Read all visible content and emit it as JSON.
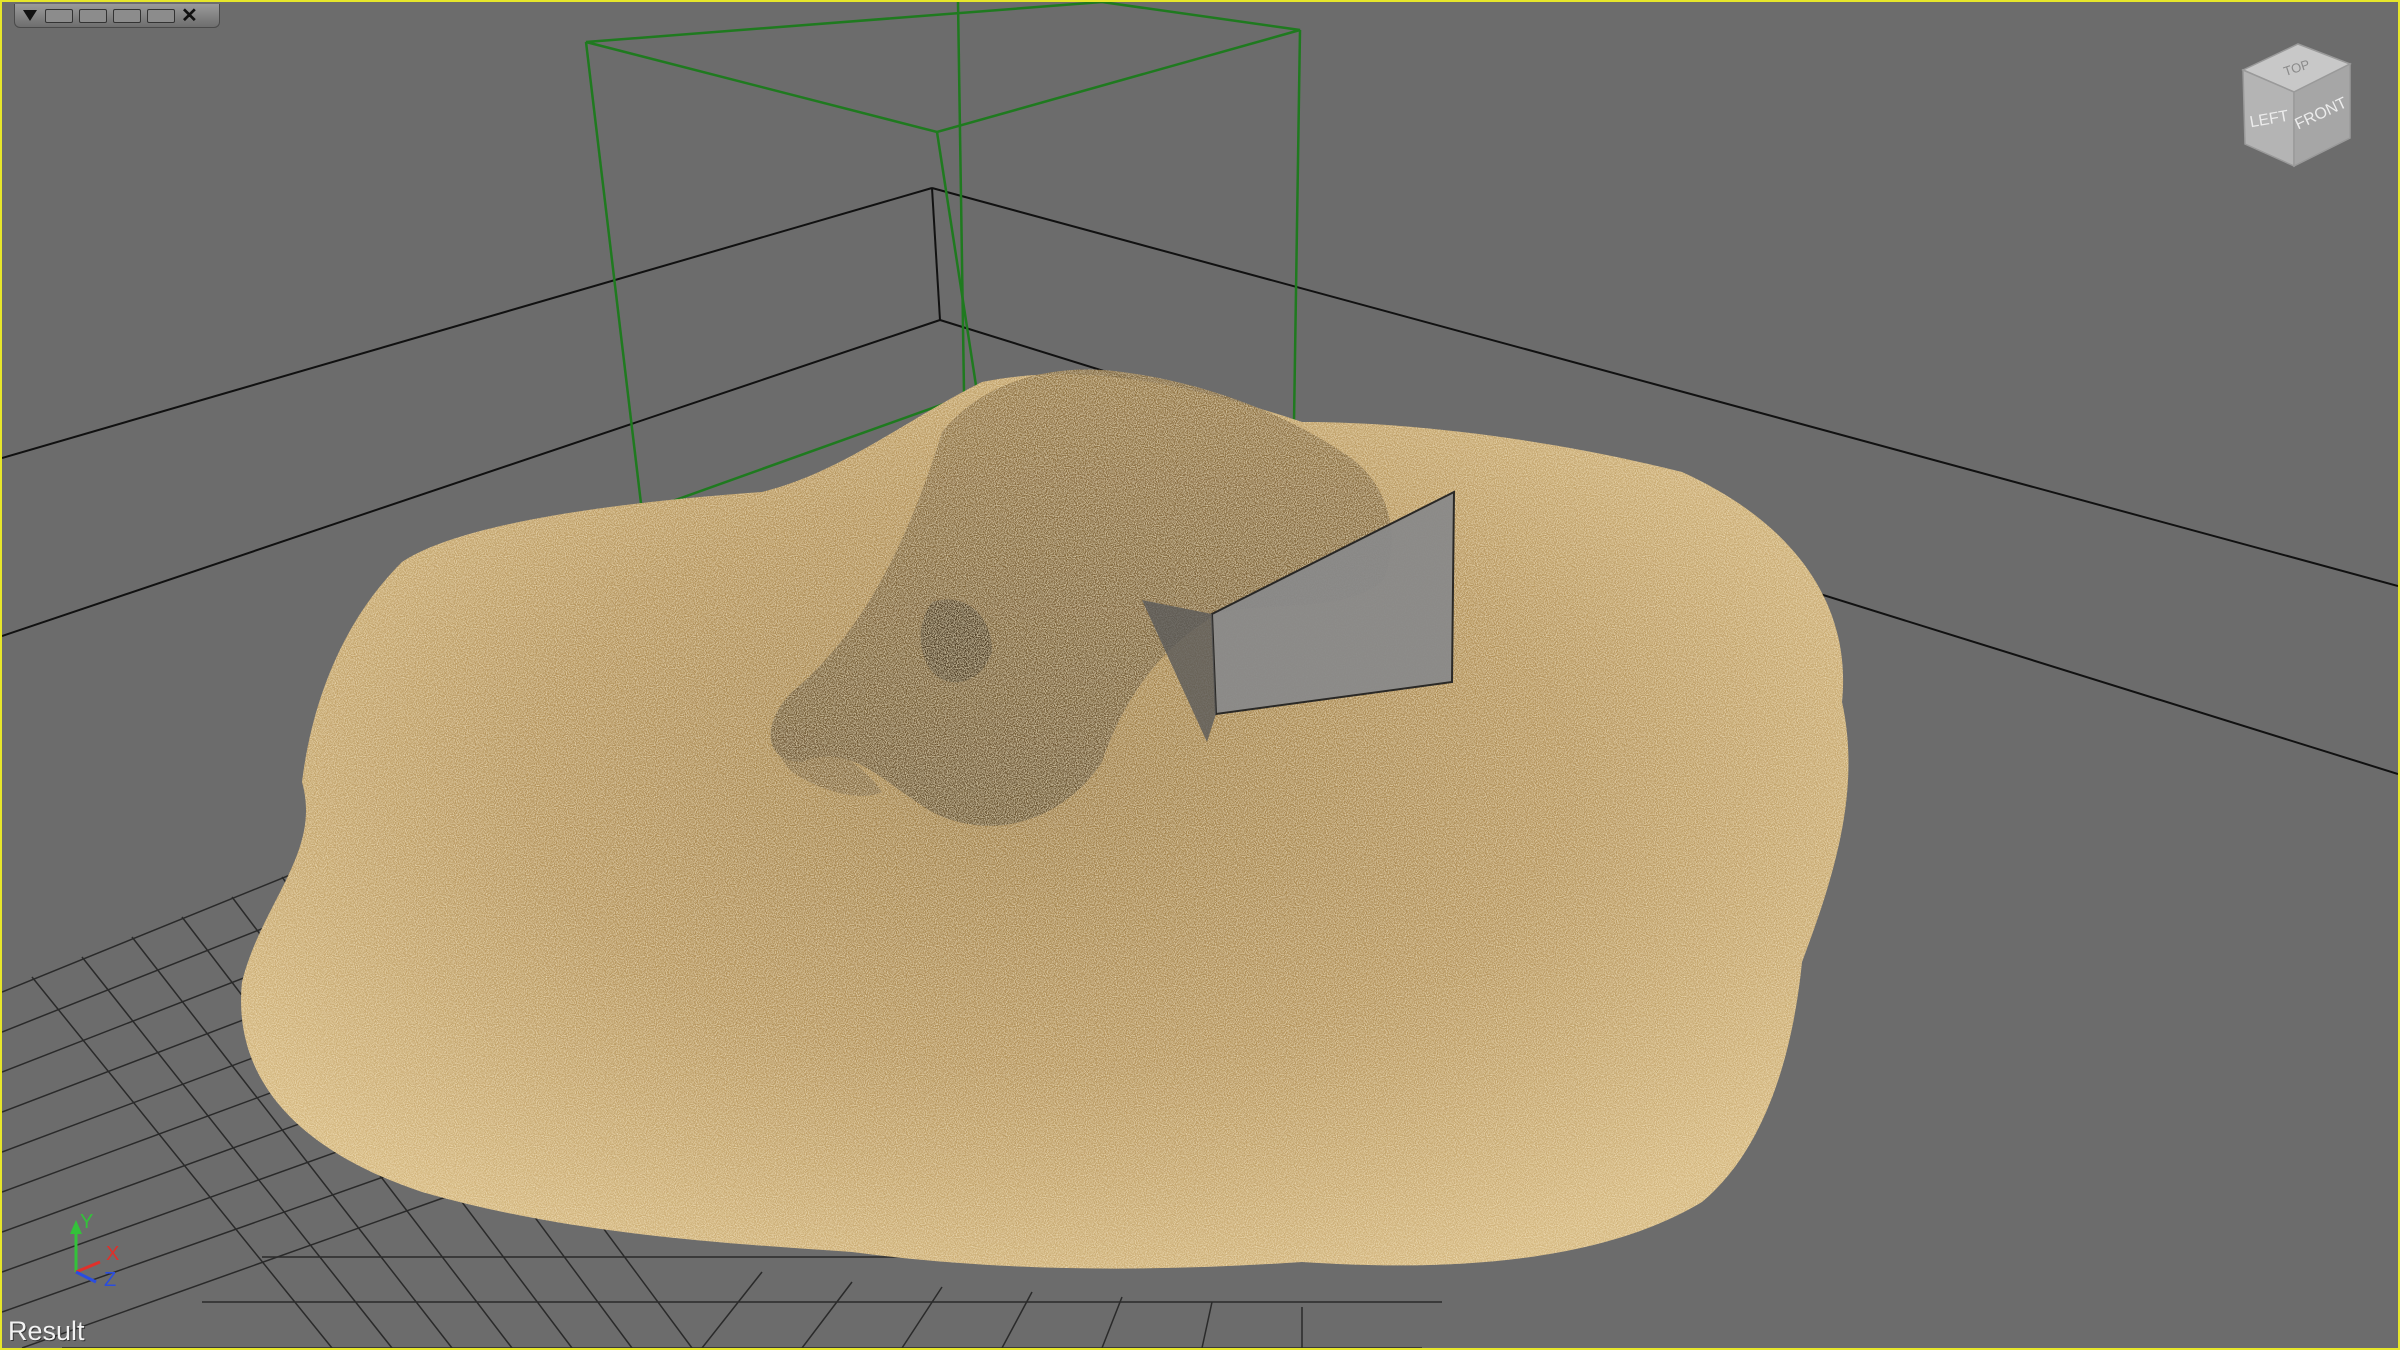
{
  "viewport": {
    "label": "Result",
    "border_color": "#e6e62a",
    "background_color": "#6c6c6c"
  },
  "toolbar": {
    "menu_icon": "triangle-down-icon",
    "close_label": "✕"
  },
  "viewcube": {
    "top_label": "TOP",
    "left_label": "LEFT",
    "front_label": "FRONT"
  },
  "axes": {
    "x_label": "X",
    "y_label": "Y",
    "z_label": "Z",
    "x_color": "#e0302a",
    "y_color": "#33c23a",
    "z_color": "#2a4de0"
  },
  "scene": {
    "emitter_box_color": "#1f7a1f",
    "grid_color": "#2a2a2a",
    "sand_color": "#b8965a",
    "sand_highlight": "#e3c78e",
    "sand_shadow": "#5e4a2a"
  }
}
